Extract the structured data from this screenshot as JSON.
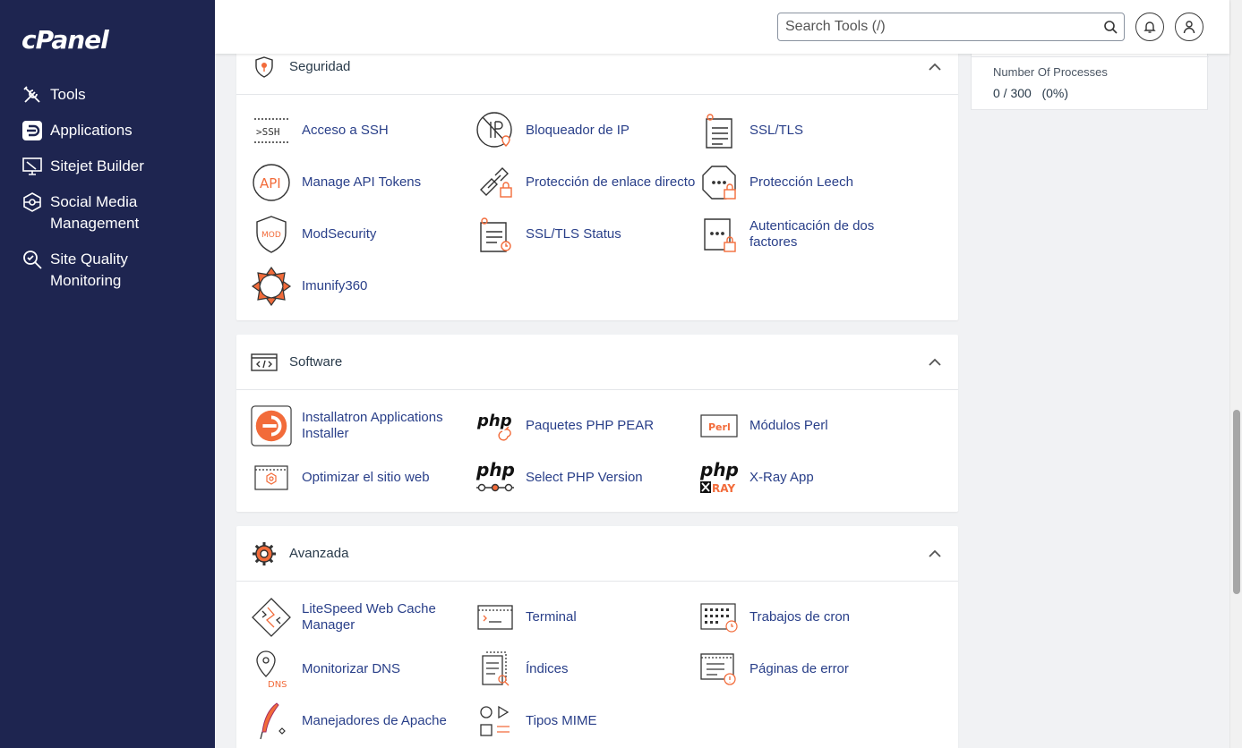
{
  "sidebar": {
    "logo": "cPanel",
    "items": [
      {
        "label": "Tools"
      },
      {
        "label": "Applications"
      },
      {
        "label": "Sitejet Builder"
      },
      {
        "label": "Social Media Management"
      },
      {
        "label": "Site Quality Monitoring"
      }
    ]
  },
  "header": {
    "search_placeholder": "Search Tools (/)"
  },
  "stats": {
    "processes_title": "Number Of Processes",
    "processes_value": "0 / 300   (0%)"
  },
  "sections": {
    "security": {
      "title": "Seguridad",
      "tools": [
        "Acceso a SSH",
        "Bloqueador de IP",
        "SSL/TLS",
        "Manage API Tokens",
        "Protección de enlace directo",
        "Protección Leech",
        "ModSecurity",
        "SSL/TLS Status",
        "Autenticación de dos factores",
        "Imunify360"
      ]
    },
    "software": {
      "title": "Software",
      "tools": [
        "Installatron Applications Installer",
        "Paquetes PHP PEAR",
        "Módulos Perl",
        "Optimizar el sitio web",
        "Select PHP Version",
        "X-Ray App"
      ]
    },
    "advanced": {
      "title": "Avanzada",
      "tools": [
        "LiteSpeed Web Cache Manager",
        "Terminal",
        "Trabajos de cron",
        "Monitorizar DNS",
        "Índices",
        "Páginas de error",
        "Manejadores de Apache",
        "Tipos MIME"
      ]
    }
  },
  "icon_text": {
    "ssh": ">SSH",
    "api": "API",
    "mod": "MOD",
    "perl": "Perl",
    "php": "php",
    "xray": "RAY",
    "dns": "DNS"
  },
  "colors": {
    "sidebar_bg": "#1e2550",
    "accent_orange": "#f26b3a",
    "link_blue": "#293f89"
  }
}
